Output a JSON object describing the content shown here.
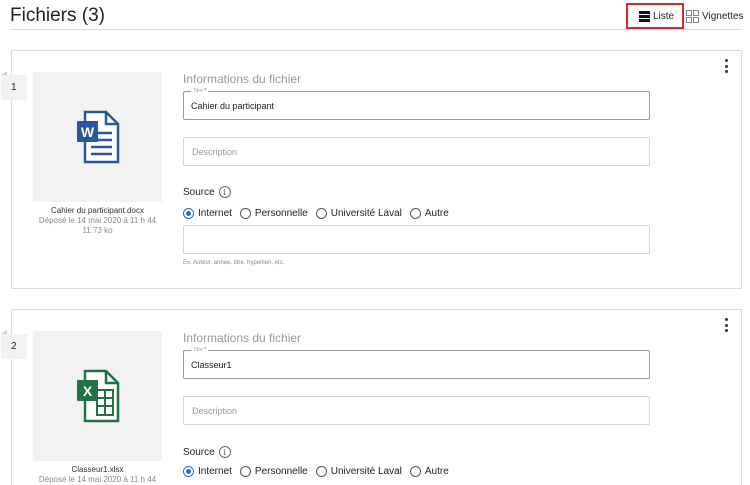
{
  "header": {
    "title": "Fichiers (3)",
    "view_list_label": "Liste",
    "view_grid_label": "Vignettes"
  },
  "colors": {
    "accent": "#1f6fd0",
    "highlight_box": "#e0242b",
    "word": "#2b579a",
    "excel": "#217346"
  },
  "cards": [
    {
      "index": "1",
      "file_icon": "word-document-icon",
      "file_name": "Cahier du participant.docx",
      "uploaded": "Déposé le 14 mai 2020 à 11 h 44",
      "size": "11.73 ko",
      "section_title": "Informations du fichier",
      "title_label": "Titre",
      "title_required": "*",
      "title_value": "Cahier du participant",
      "description_placeholder": "Description",
      "source_label": "Source",
      "source_options": [
        "Internet",
        "Personnelle",
        "Université Laval",
        "Autre"
      ],
      "source_selected": "Internet",
      "source_hint": "Ex. Auteur, année, titre, hyperlien, etc."
    },
    {
      "index": "2",
      "file_icon": "excel-spreadsheet-icon",
      "file_name": "Classeur1.xlsx",
      "uploaded": "Déposé le 14 mai 2020 à 11 h 44",
      "section_title": "Informations du fichier",
      "title_label": "Titre",
      "title_required": "*",
      "title_value": "Classeur1",
      "description_placeholder": "Description",
      "source_label": "Source",
      "source_options": [
        "Internet",
        "Personnelle",
        "Université Laval",
        "Autre"
      ],
      "source_selected": "Internet"
    }
  ]
}
